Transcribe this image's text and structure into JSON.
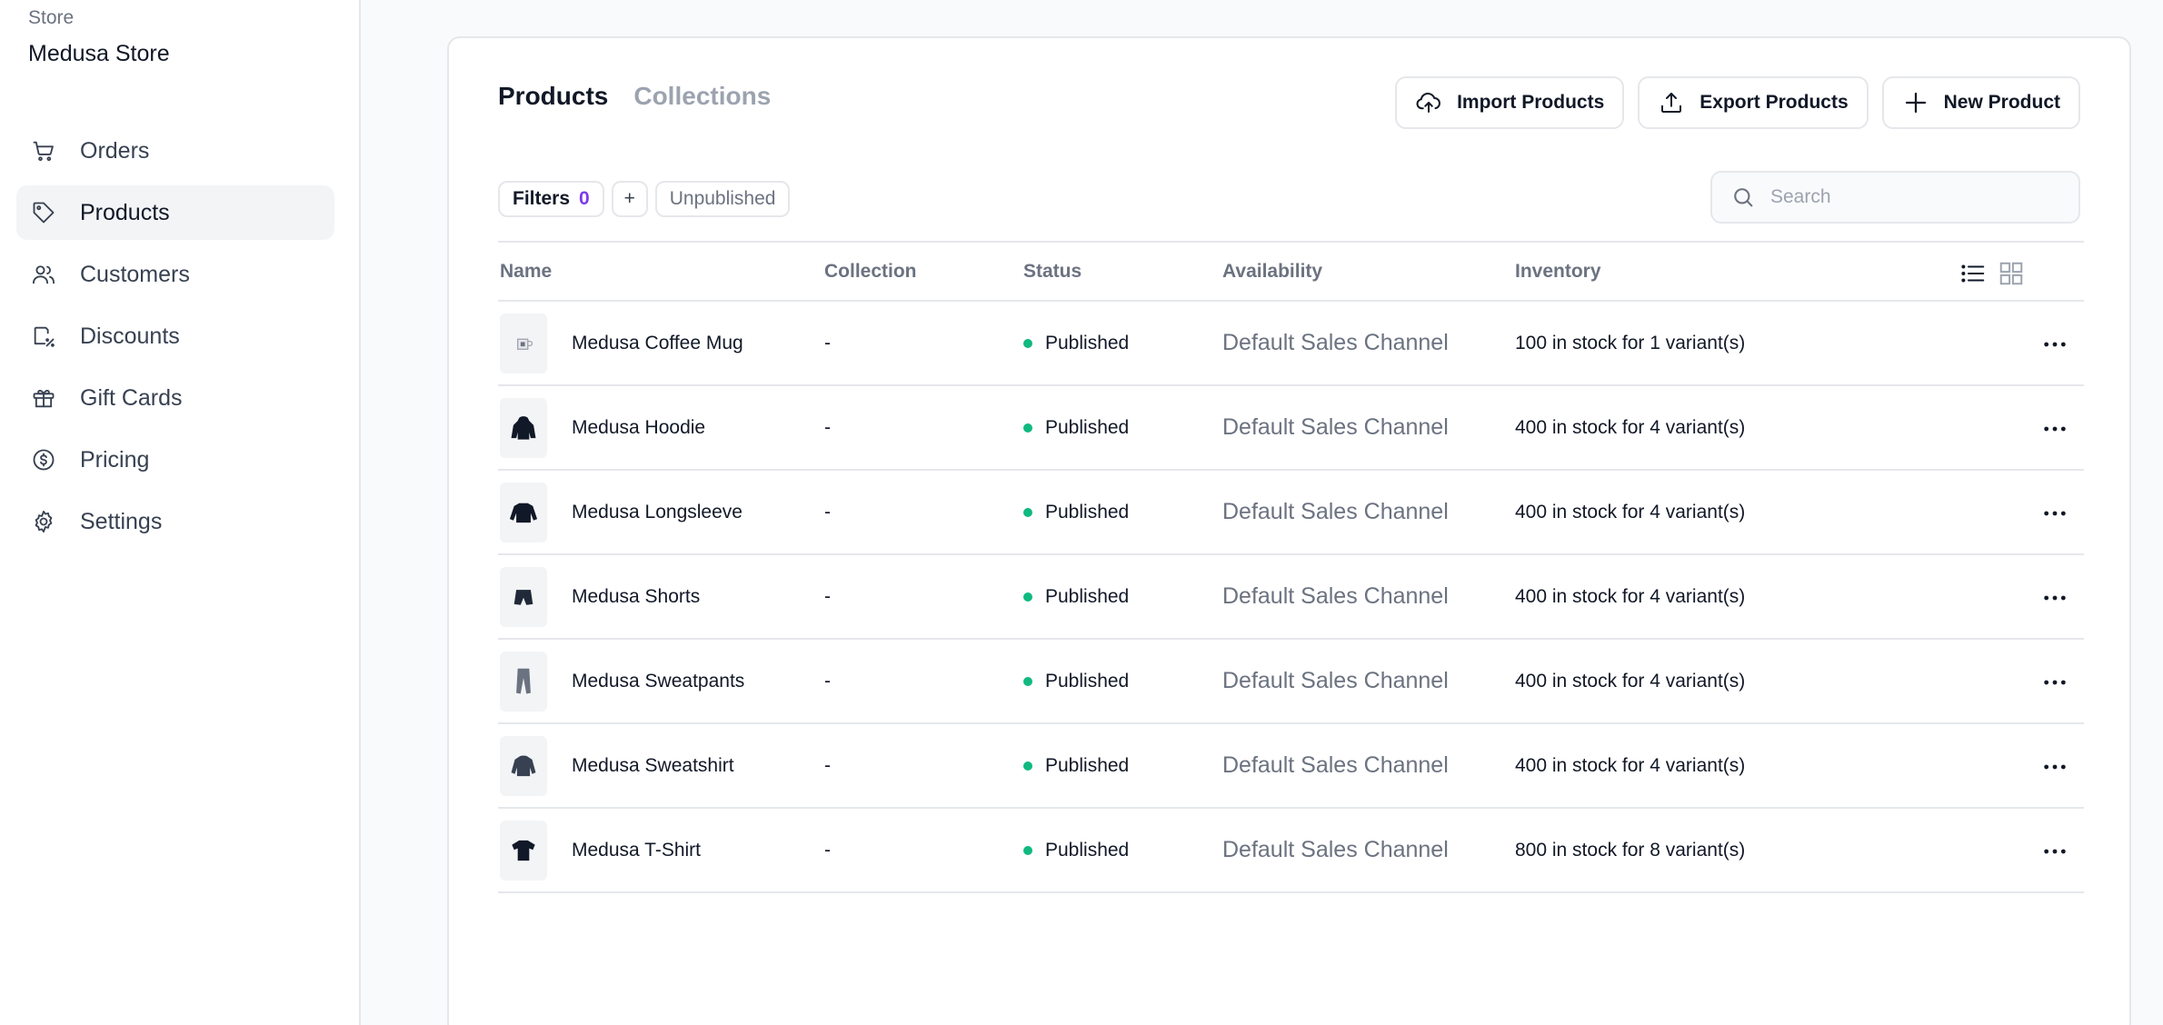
{
  "sidebar": {
    "store_label": "Store",
    "store_name": "Medusa Store",
    "items": [
      {
        "label": "Orders",
        "icon": "cart-icon"
      },
      {
        "label": "Products",
        "icon": "tag-icon"
      },
      {
        "label": "Customers",
        "icon": "users-icon"
      },
      {
        "label": "Discounts",
        "icon": "discount-icon"
      },
      {
        "label": "Gift Cards",
        "icon": "gift-icon"
      },
      {
        "label": "Pricing",
        "icon": "dollar-icon"
      },
      {
        "label": "Settings",
        "icon": "gear-icon"
      }
    ],
    "active": "Products"
  },
  "tabs": [
    {
      "label": "Products",
      "active": true
    },
    {
      "label": "Collections",
      "active": false
    }
  ],
  "actions": {
    "import_label": "Import Products",
    "export_label": "Export Products",
    "new_label": "New Product"
  },
  "filters": {
    "label": "Filters",
    "count": "0",
    "add": "+",
    "chip": "Unpublished"
  },
  "search": {
    "placeholder": "Search",
    "value": ""
  },
  "table": {
    "headers": [
      "Name",
      "Collection",
      "Status",
      "Availability",
      "Inventory"
    ],
    "rows": [
      {
        "name": "Medusa Coffee Mug",
        "collection": "-",
        "status": "Published",
        "availability": "Default Sales Channel",
        "inventory": "100 in stock for 1 variant(s)",
        "thumb": "mug"
      },
      {
        "name": "Medusa Hoodie",
        "collection": "-",
        "status": "Published",
        "availability": "Default Sales Channel",
        "inventory": "400 in stock for 4 variant(s)",
        "thumb": "hoodie"
      },
      {
        "name": "Medusa Longsleeve",
        "collection": "-",
        "status": "Published",
        "availability": "Default Sales Channel",
        "inventory": "400 in stock for 4 variant(s)",
        "thumb": "longsleeve"
      },
      {
        "name": "Medusa Shorts",
        "collection": "-",
        "status": "Published",
        "availability": "Default Sales Channel",
        "inventory": "400 in stock for 4 variant(s)",
        "thumb": "shorts"
      },
      {
        "name": "Medusa Sweatpants",
        "collection": "-",
        "status": "Published",
        "availability": "Default Sales Channel",
        "inventory": "400 in stock for 4 variant(s)",
        "thumb": "sweatpants"
      },
      {
        "name": "Medusa Sweatshirt",
        "collection": "-",
        "status": "Published",
        "availability": "Default Sales Channel",
        "inventory": "400 in stock for 4 variant(s)",
        "thumb": "sweatshirt"
      },
      {
        "name": "Medusa T-Shirt",
        "collection": "-",
        "status": "Published",
        "availability": "Default Sales Channel",
        "inventory": "800 in stock for 8 variant(s)",
        "thumb": "tshirt"
      }
    ]
  },
  "colors": {
    "accent": "#7c3aed",
    "published": "#10b981",
    "border": "#e5e7eb"
  }
}
